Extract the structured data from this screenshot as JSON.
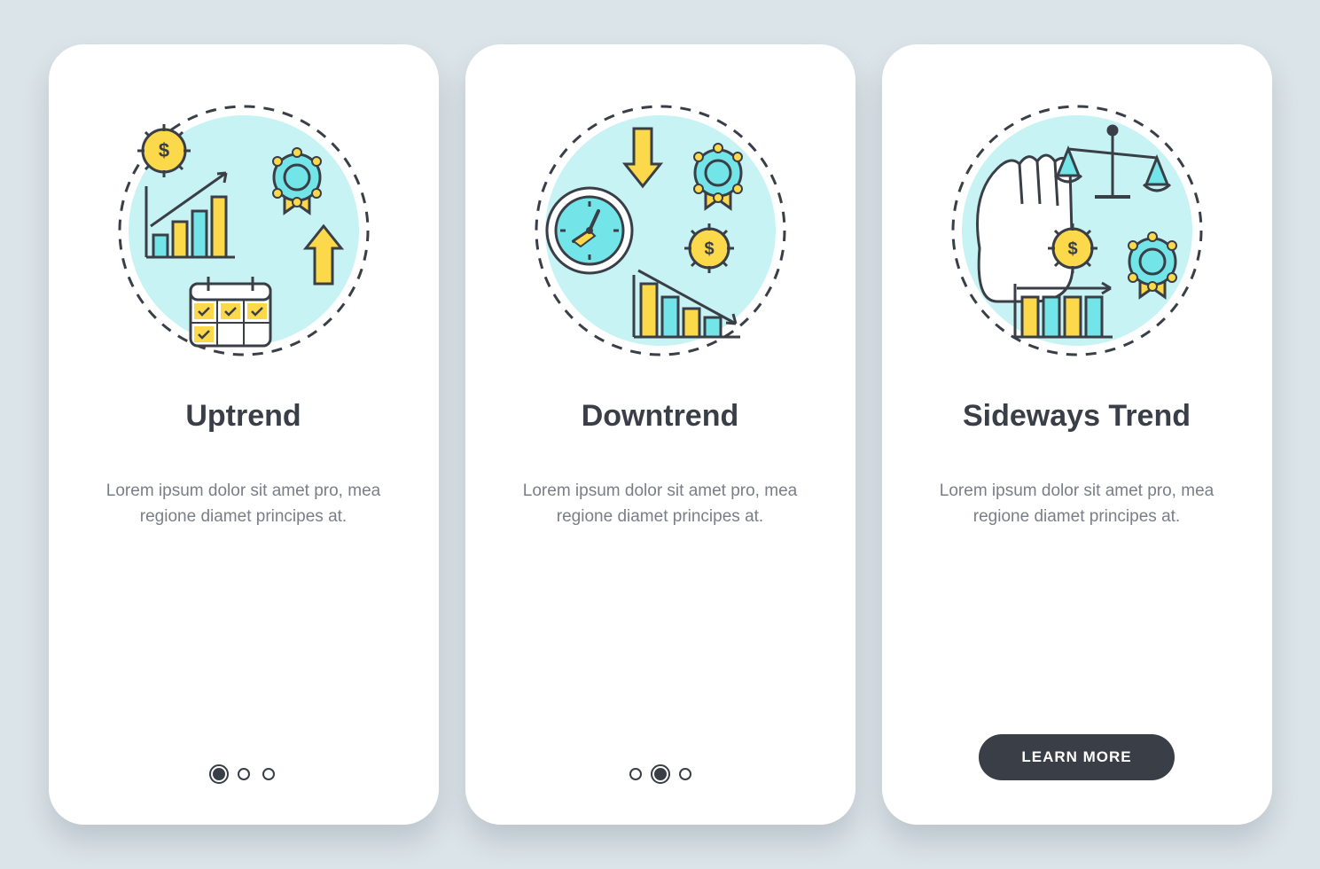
{
  "colors": {
    "yellow": "#fcd94a",
    "teal": "#73e5e8",
    "tealLight": "#c7f3f4",
    "dark": "#3a3e47"
  },
  "cards": [
    {
      "title": "Uptrend",
      "body": "Lorem ipsum dolor sit amet pro, mea regione diamet principes at.",
      "activeDot": 0,
      "showButton": false
    },
    {
      "title": "Downtrend",
      "body": "Lorem ipsum dolor sit amet pro, mea regione diamet principes at.",
      "activeDot": 1,
      "showButton": false
    },
    {
      "title": "Sideways Trend",
      "body": "Lorem ipsum dolor sit amet pro, mea regione diamet principes at.",
      "activeDot": 2,
      "showButton": true,
      "buttonLabel": "LEARN MORE"
    }
  ]
}
